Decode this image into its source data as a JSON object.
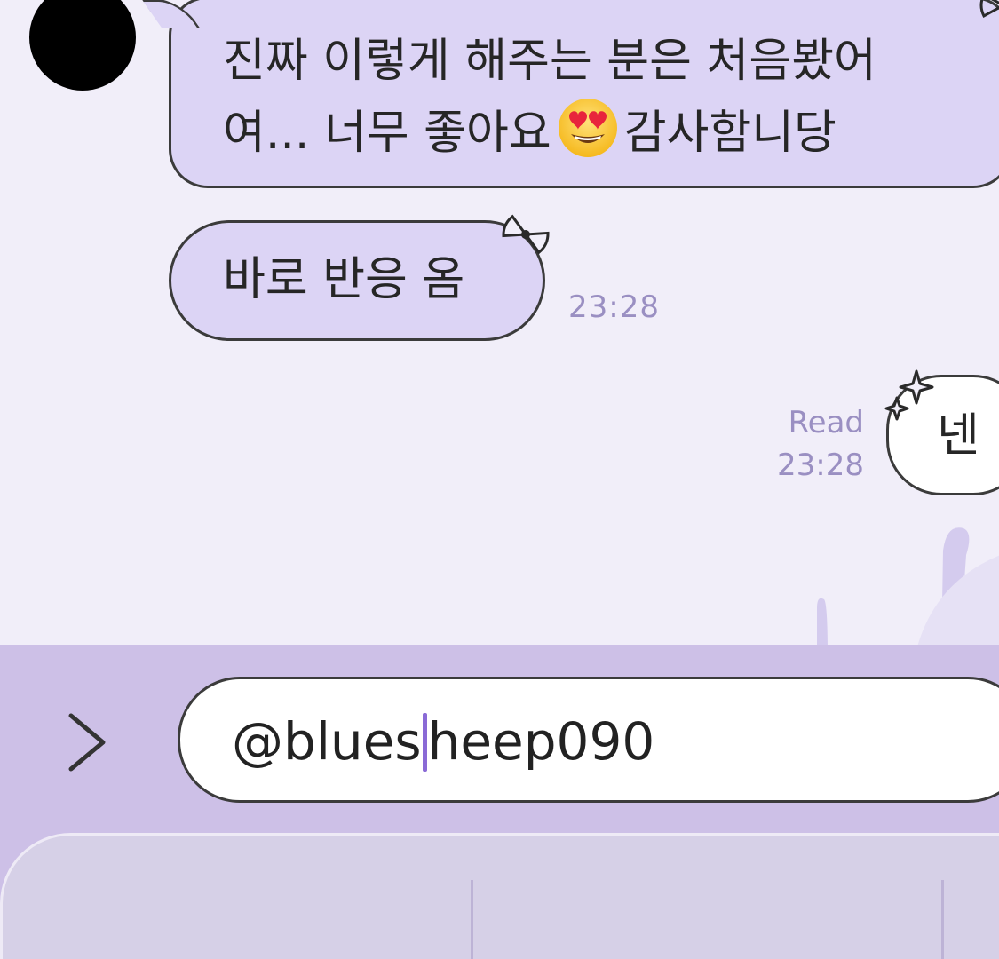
{
  "chat": {
    "incoming": [
      {
        "line1": "진짜 이렇게 해주는 분은 처음봤어",
        "line2_before_emoji": "여... 너무 좋아요",
        "emoji": "heart-eyes-emoji",
        "line2_after_emoji": "감사함니당"
      },
      {
        "text": "바로 반응 옴",
        "time": "23:28"
      }
    ],
    "outgoing": [
      {
        "text": "넨",
        "status": "Read",
        "time": "23:28"
      }
    ]
  },
  "composer": {
    "text_before_caret": "@blues",
    "text_after_caret": "heep090",
    "expand_icon": "chevron-right-icon"
  },
  "colors": {
    "chat_background": "#f1eef9",
    "incoming_bubble": "#dcd4f5",
    "outgoing_bubble": "#ffffff",
    "input_bar": "#cdc0e7",
    "timestamp": "#9a8fc2",
    "caret": "#8a6ad6"
  }
}
